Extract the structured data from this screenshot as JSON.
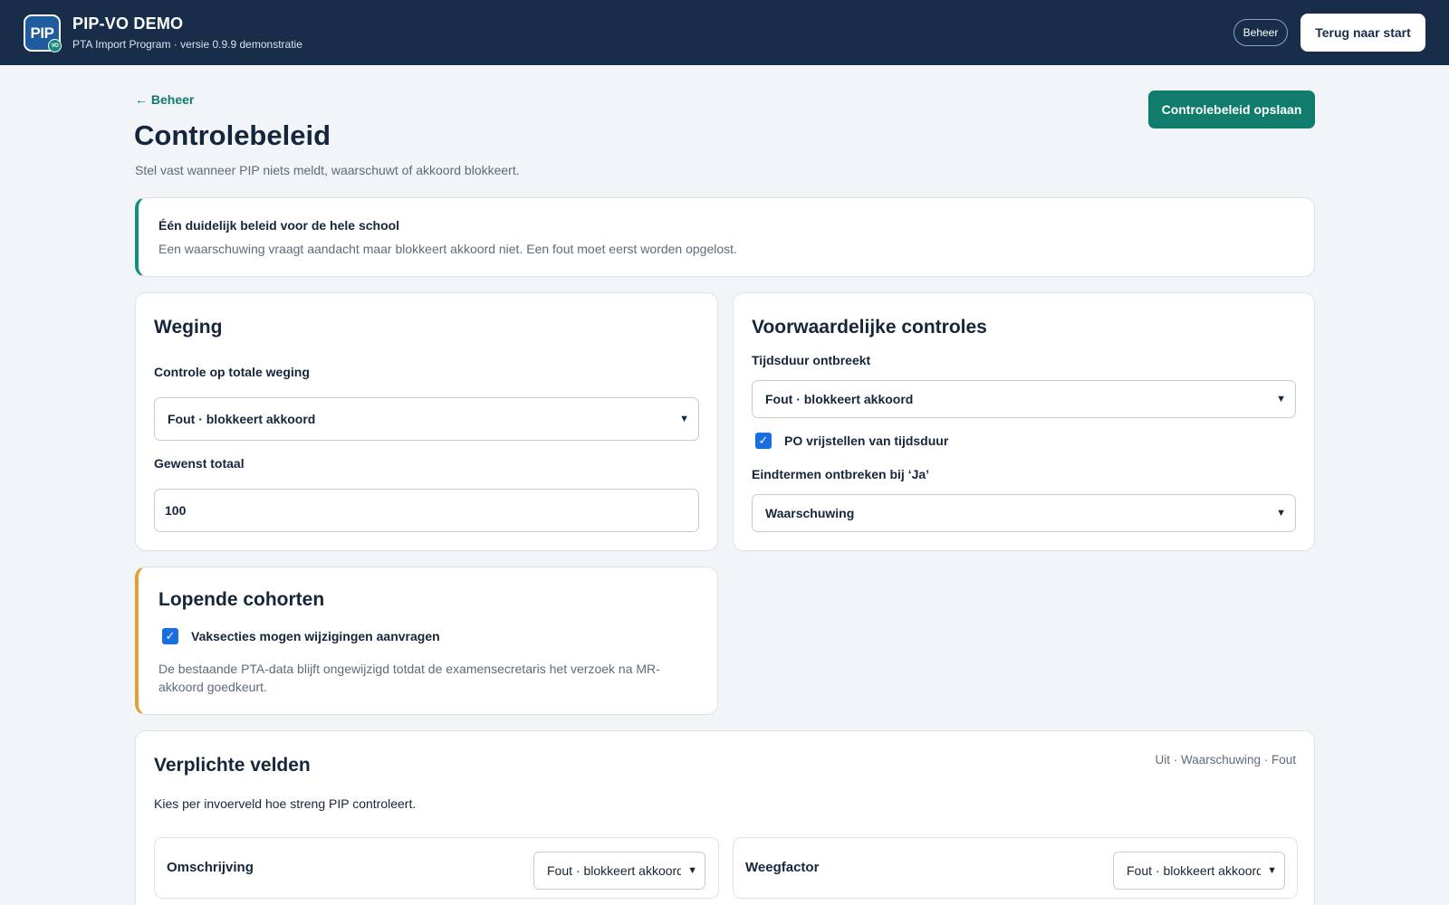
{
  "header": {
    "logo_text": "PIP",
    "logo_badge": "VO",
    "app_title": "PIP-VO DEMO",
    "app_subtitle": "PTA Import Program · versie 0.9.9 demonstratie",
    "beheer_label": "Beheer",
    "start_label": "Terug naar start"
  },
  "page": {
    "back_label": "← Beheer",
    "title": "Controlebeleid",
    "description": "Stel vast wanneer PIP niets meldt, waarschuwt of akkoord blokkeert.",
    "save_label": "Controlebeleid opslaan"
  },
  "info": {
    "title": "Één duidelijk beleid voor de hele school",
    "text": "Een waarschuwing vraagt aandacht maar blokkeert akkoord niet. Een fout moet eerst worden opgelost."
  },
  "weging": {
    "title": "Weging",
    "total_check_label": "Controle op totale weging",
    "total_check_value": "Fout · blokkeert akkoord",
    "desired_total_label": "Gewenst totaal",
    "desired_total_value": "100"
  },
  "conditional": {
    "title": "Voorwaardelijke controles",
    "duration_label": "Tijdsduur ontbreekt",
    "duration_value": "Fout · blokkeert akkoord",
    "po_exempt_label": "PO vrijstellen van tijdsduur",
    "po_exempt_checked": true,
    "endterms_label": "Eindtermen ontbreken bij ‘Ja’",
    "endterms_value": "Waarschuwing"
  },
  "cohorts": {
    "title": "Lopende cohorten",
    "request_label": "Vaksecties mogen wijzigingen aanvragen",
    "request_checked": true,
    "note": "De bestaande PTA-data blijft ongewijzigd totdat de examensecretaris het verzoek na MR-akkoord goedkeurt."
  },
  "required": {
    "title": "Verplichte velden",
    "legend": "Uit · Waarschuwing · Fout",
    "description": "Kies per invoerveld hoe streng PIP controleert.",
    "fields": [
      {
        "label": "Omschrijving",
        "value": "Fout · blokkeert akkoord"
      },
      {
        "label": "Weegfactor",
        "value": "Fout · blokkeert akkoord"
      }
    ]
  },
  "colors": {
    "header_bg": "#182d49",
    "accent_teal": "#0f7c6c",
    "accent_orange": "#e3a02c",
    "checkbox_blue": "#1a6fe0"
  }
}
